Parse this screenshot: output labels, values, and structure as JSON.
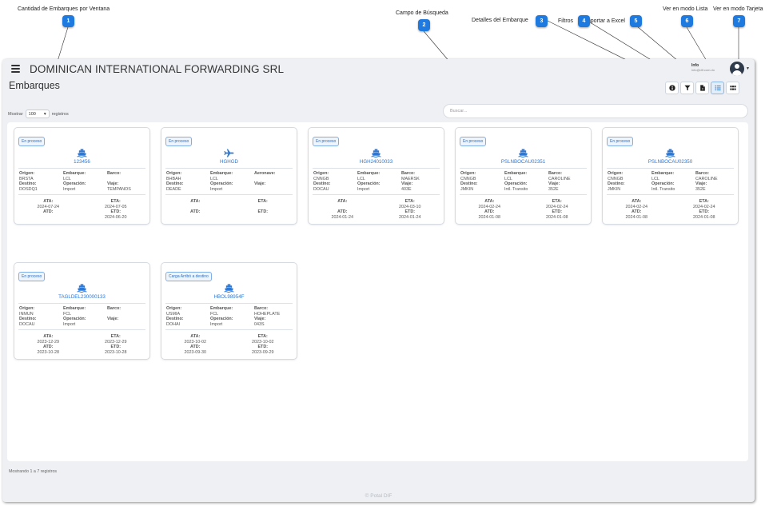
{
  "callouts": [
    {
      "label": "Cantidad de Embarques por Ventana",
      "number": "1"
    },
    {
      "label": "Campo de Búsqueda",
      "number": "2"
    },
    {
      "label": "Detalles del Embarque",
      "number": "3"
    },
    {
      "label": "Filtros",
      "number": "4"
    },
    {
      "label": "Importar a Excel",
      "number": "5"
    },
    {
      "label": "Ver en modo Lista",
      "number": "6"
    },
    {
      "label": "Ver en modo Tarjeta",
      "number": "7"
    }
  ],
  "header": {
    "company": "DOMINICAN INTERNATIONAL FORWARDING SRL",
    "user_name": "Info",
    "user_email": "info@dif.com.do",
    "page_title": "Embarques"
  },
  "toolbar": {
    "buttons": [
      {
        "icon": "info-circle-icon"
      },
      {
        "icon": "filter-icon"
      },
      {
        "icon": "excel-file-icon"
      },
      {
        "icon": "list-view-icon",
        "active": true
      },
      {
        "icon": "grid-view-icon"
      }
    ]
  },
  "controls": {
    "show_prefix": "Mostrar",
    "page_size": "100",
    "show_suffix": "registros",
    "search_placeholder": "Buscar..."
  },
  "labels": {
    "origin": "Origen:",
    "shipment": "Embarque:",
    "destination": "Destino:",
    "operation": "Operación:",
    "voyage": "Viaje:",
    "ata": "ATA:",
    "eta": "ETA:",
    "atd": "ATD:",
    "etd": "ETD:"
  },
  "cards": [
    {
      "status": "En proceso",
      "icon": "ship-icon",
      "id": "123456",
      "carrier_label": "Barco:",
      "origin": "BRSTA",
      "shipment": "LCL",
      "carrier": "",
      "destination": "DOSDQ1",
      "operation": "Import",
      "voyage": "TEMPANOS",
      "ata": "2024-07-24",
      "eta": "2024-07-05",
      "atd": "",
      "etd": "2024-06-20"
    },
    {
      "status": "En proceso",
      "icon": "plane-icon",
      "id": "HGHGD",
      "carrier_label": "Aeronave:",
      "origin": "BHBAH",
      "shipment": "LCL",
      "carrier": "",
      "destination": "DEADE",
      "operation": "Import",
      "voyage": "",
      "ata": "",
      "eta": "",
      "atd": "",
      "etd": ""
    },
    {
      "status": "En proceso",
      "icon": "ship-icon",
      "id": "HGH24010033",
      "carrier_label": "Barco:",
      "origin": "CNNGB",
      "shipment": "LCL",
      "carrier": "MAERSK",
      "destination": "DOCAU",
      "operation": "Import",
      "voyage": "403E",
      "ata": "",
      "eta": "2024-03-10",
      "atd": "2024-01-24",
      "etd": "2024-01-24"
    },
    {
      "status": "En proceso",
      "icon": "ship-icon",
      "id": "PSLNBOCAU02351",
      "carrier_label": "Barco:",
      "origin": "CNNGB",
      "shipment": "LCL",
      "carrier": "CAROLINE",
      "destination": "JMKIN",
      "operation": "Intl. Transito",
      "voyage": "352E",
      "ata": "2024-02-24",
      "eta": "2024-02-24",
      "atd": "2024-01-08",
      "etd": "2024-01-08"
    },
    {
      "status": "En proceso",
      "icon": "ship-icon",
      "id": "PSLNBOCAU02350",
      "carrier_label": "Barco:",
      "origin": "CNNGB",
      "shipment": "LCL",
      "carrier": "CAROLINE",
      "destination": "JMKIN",
      "operation": "Intl. Transito",
      "voyage": "352E",
      "ata": "2024-02-24",
      "eta": "2024-02-24",
      "atd": "2024-01-08",
      "etd": "2024-01-08"
    },
    {
      "status": "En proceso",
      "icon": "ship-icon",
      "id": "TAGLDEL230000133",
      "carrier_label": "Barco:",
      "origin": "INMUN",
      "shipment": "FCL",
      "carrier": "",
      "destination": "DOCAU",
      "operation": "Import",
      "voyage": "",
      "ata": "2023-12-29",
      "eta": "2023-12-29",
      "atd": "2023-10-28",
      "etd": "2023-10-28"
    },
    {
      "status": "Carga Arribó a destino",
      "icon": "ship-icon",
      "id": "HBOL98954F",
      "carrier_label": "Barco:",
      "origin": "USMIA",
      "shipment": "FCL",
      "carrier": "HOHEPLATE",
      "destination": "DOHAI",
      "operation": "Import",
      "voyage": "043S",
      "ata": "2023-10-02",
      "eta": "2023-10-02",
      "atd": "2023-09-30",
      "etd": "2023-09-29"
    }
  ],
  "footer": {
    "count_text": "Mostrando 1 a 7 registros",
    "copyright": "© Potal DIF"
  },
  "colors": {
    "accent": "#1f7ae0",
    "link": "#2a78d8"
  }
}
